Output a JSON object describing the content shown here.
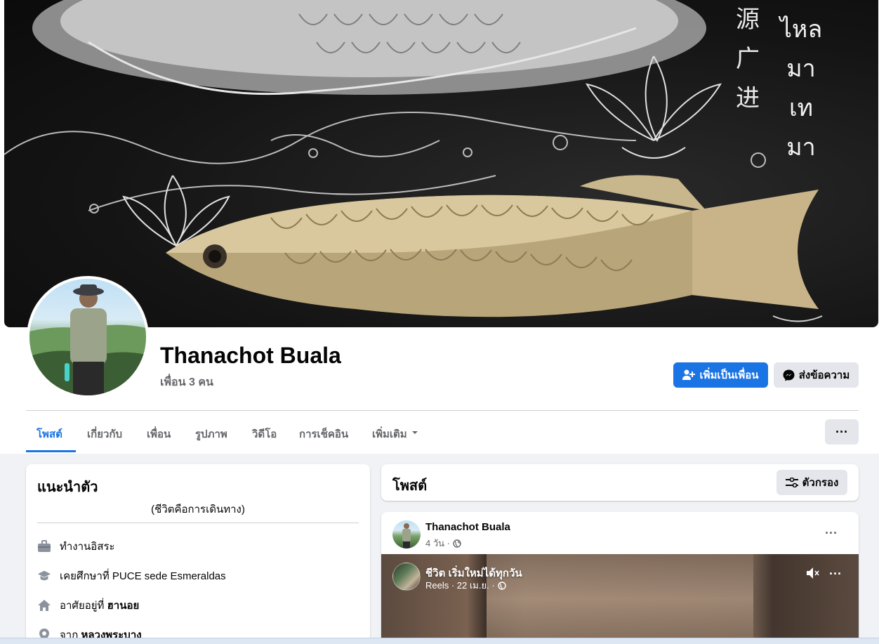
{
  "cover": {
    "cjk_text": [
      "源",
      "广",
      "进"
    ],
    "thai_text": [
      "ไหล",
      "มา",
      "เท",
      "มา"
    ]
  },
  "profile": {
    "name": "Thanachot Buala",
    "friends": "เพื่อน 3 คน",
    "add_friend_label": "เพิ่มเป็นเพื่อน",
    "message_label": "ส่งข้อความ"
  },
  "tabs": [
    {
      "label": "โพสต์",
      "active": true
    },
    {
      "label": "เกี่ยวกับ",
      "active": false
    },
    {
      "label": "เพื่อน",
      "active": false
    },
    {
      "label": "รูปภาพ",
      "active": false
    },
    {
      "label": "วิดีโอ",
      "active": false
    },
    {
      "label": "การเช็คอิน",
      "active": false
    },
    {
      "label": "เพิ่มเติม",
      "active": false
    }
  ],
  "more_options": "···",
  "intro": {
    "title": "แนะนำตัว",
    "bio": "(ชีวิตคือการเดินทาง)",
    "items": [
      {
        "icon": "briefcase-icon",
        "text": "ทำงานอิสระ"
      },
      {
        "icon": "graduation-cap-icon",
        "text": "เคยศึกษาที่ PUCE sede Esmeraldas"
      },
      {
        "icon": "home-icon",
        "text": "อาศัยอยู่ที่ ",
        "bold": "ฮานอย"
      },
      {
        "icon": "location-pin-icon",
        "text": "จาก ",
        "bold": "หลวงพระบาง"
      }
    ]
  },
  "posts": {
    "title": "โพสต์",
    "filter_label": "ตัวกรอง"
  },
  "post": {
    "author": "Thanachot Buala",
    "time": "4 วัน ·",
    "options": "···",
    "reel": {
      "title": "ชีวิต เริ่มใหม่ได้ทุกวัน",
      "meta": "Reels · 22 เม.ย. ·",
      "options": "···"
    }
  },
  "colors": {
    "primary": "#1b74e4",
    "background": "#f0f2f5",
    "secondary_button": "#e4e6eb",
    "muted_text": "#65676b"
  }
}
